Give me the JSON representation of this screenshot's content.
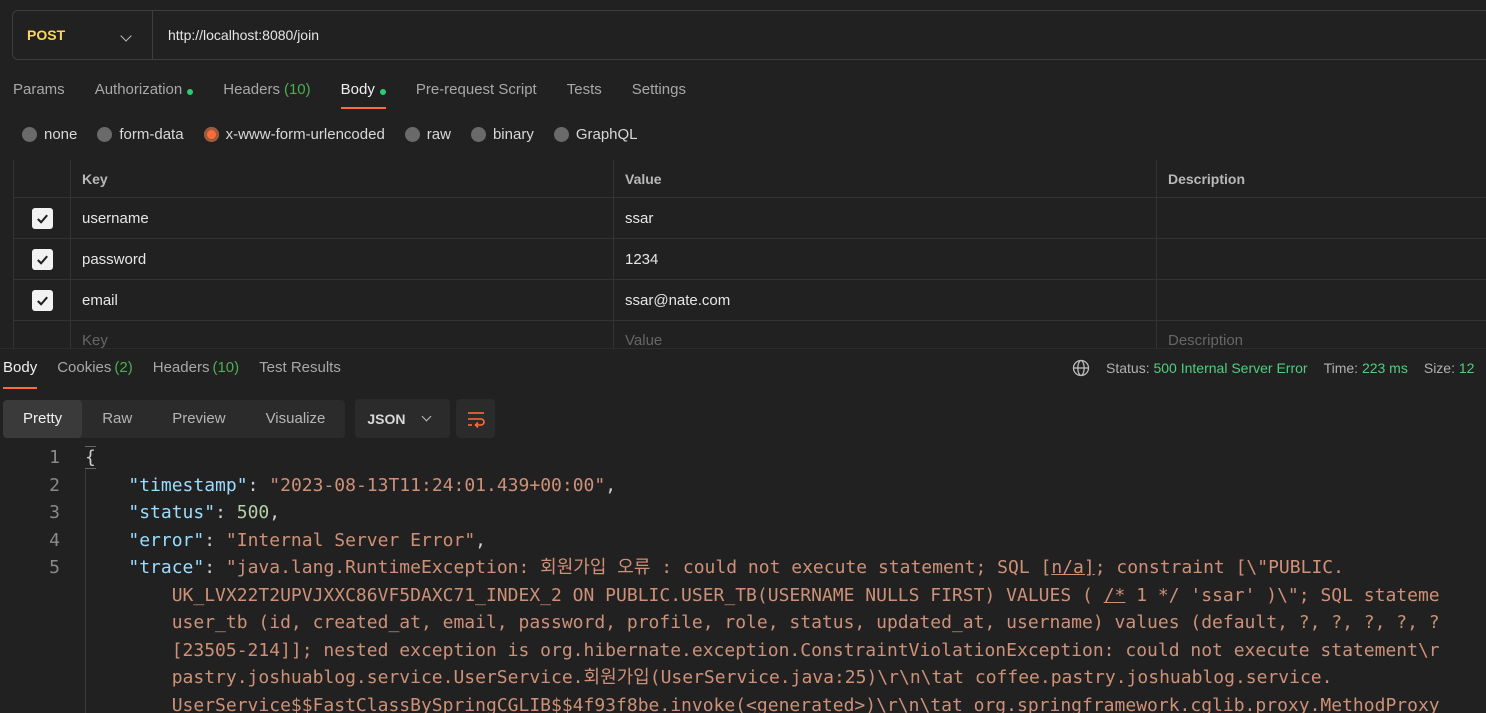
{
  "request": {
    "method": "POST",
    "url": "http://localhost:8080/join"
  },
  "request_tabs": [
    {
      "label": "Params",
      "count": "",
      "dot": false
    },
    {
      "label": "Authorization",
      "count": "",
      "dot": true
    },
    {
      "label": "Headers",
      "count": "(10)",
      "dot": false
    },
    {
      "label": "Body",
      "count": "",
      "dot": true
    },
    {
      "label": "Pre-request Script",
      "count": "",
      "dot": false
    },
    {
      "label": "Tests",
      "count": "",
      "dot": false
    },
    {
      "label": "Settings",
      "count": "",
      "dot": false
    }
  ],
  "body_types": [
    "none",
    "form-data",
    "x-www-form-urlencoded",
    "raw",
    "binary",
    "GraphQL"
  ],
  "selected_body_type": "x-www-form-urlencoded",
  "params_table": {
    "headers": [
      "Key",
      "Value",
      "Description"
    ],
    "rows": [
      {
        "checked": true,
        "key": "username",
        "value": "ssar",
        "description": ""
      },
      {
        "checked": true,
        "key": "password",
        "value": "1234",
        "description": ""
      },
      {
        "checked": true,
        "key": "email",
        "value": "ssar@nate.com",
        "description": ""
      }
    ],
    "placeholders": {
      "key": "Key",
      "value": "Value",
      "description": "Description"
    }
  },
  "response_tabs": [
    {
      "label": "Body",
      "count": ""
    },
    {
      "label": "Cookies",
      "count": "(2)"
    },
    {
      "label": "Headers",
      "count": "(10)"
    },
    {
      "label": "Test Results",
      "count": ""
    }
  ],
  "response_status": {
    "status_label": "Status:",
    "status_value": "500 Internal Server Error",
    "time_label": "Time:",
    "time_value": "223 ms",
    "size_label": "Size:",
    "size_value": "12"
  },
  "view_modes": [
    "Pretty",
    "Raw",
    "Preview",
    "Visualize"
  ],
  "active_view_mode": "Pretty",
  "format": "JSON",
  "code": {
    "line_numbers": [
      "1",
      "2",
      "3",
      "4",
      "5",
      "",
      "",
      "",
      "",
      ""
    ],
    "lines": {
      "l1": "{",
      "l2_key": "\"timestamp\"",
      "l2_val": "\"2023-08-13T11:24:01.439+00:00\"",
      "l3_key": "\"status\"",
      "l3_val": "500",
      "l4_key": "\"error\"",
      "l4_val": "\"Internal Server Error\"",
      "l5_key": "\"trace\"",
      "l5_val_a": "\"java.lang.RuntimeException: 회원가입 오류 : could not execute statement; SQL [",
      "l5_val_ul": "n/a]",
      "l5_val_b": "; constraint [\\\"PUBLIC.",
      "w1_a": "UK_LVX22T2UPVJXXC86VF5DAXC71_INDEX_2 ON PUBLIC.USER_TB(USERNAME NULLS FIRST) VALUES ( ",
      "w1_ul": "/*",
      "w1_b": " 1 */ 'ssar' )\\\"; SQL stateme",
      "w2": "user_tb (id, created_at, email, password, profile, role, status, updated_at, username) values (default, ?, ?, ?, ?, ?",
      "w3": "[23505-214]]; nested exception is org.hibernate.exception.ConstraintViolationException: could not execute statement\\r",
      "w4": "pastry.joshuablog.service.UserService.회원가입(UserService.java:25)\\r\\n\\tat coffee.pastry.joshuablog.service.",
      "w5": "UserService$$FastClassBySpringCGLIB$$4f93f8be.invoke(<generated>)\\r\\n\\tat org.springframework.cglib.proxy.MethodProxy"
    }
  },
  "colors": {
    "accent": "#ff6c37",
    "method": "#ffd55a",
    "status_ok_green": "#4fcf7e",
    "json_key": "#9cdcfe",
    "json_string": "#ce9178",
    "json_number": "#b5cea8"
  }
}
